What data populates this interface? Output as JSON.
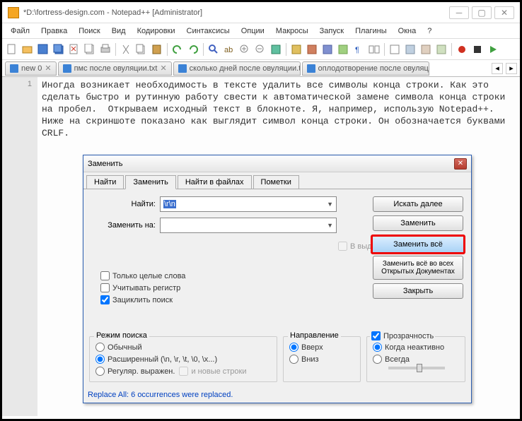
{
  "title": "*D:\\fortress-design.com - Notepad++ [Administrator]",
  "menus": [
    "Файл",
    "Правка",
    "Поиск",
    "Вид",
    "Кодировки",
    "Синтаксисы",
    "Опции",
    "Макросы",
    "Запуск",
    "Плагины",
    "Окна",
    "?"
  ],
  "file_tabs": [
    "new 0",
    "пмс после овуляции.txt",
    "сколько дней после овуляции.txt",
    "оплодотворение после овуляции.txt"
  ],
  "line_num": "1",
  "editor_text": "Иногда возникает необходимость в тексте удалить все символы конца строки. Как это сделать быстро и рутинную работу свести к автоматической замене символа конца строки на пробел.  Открываем исходный текст в блокноте. Я, например, использую Notepad++.  Ниже на скриншоте показано как выглядит символ конца строки. Он обозначается буквами CRLF.",
  "dlg": {
    "title": "Заменить",
    "tabs": [
      "Найти",
      "Заменить",
      "Найти в файлах",
      "Пометки"
    ],
    "find_lbl": "Найти:",
    "replace_lbl": "Заменить на:",
    "find_val": "\\r\\n",
    "in_sel": "В выделенном",
    "btn_next": "Искать далее",
    "btn_replace": "Заменить",
    "btn_replace_all": "Заменить всё",
    "btn_replace_all_open": "Заменить всё во всех Открытых Документах",
    "btn_close": "Закрыть",
    "chk_whole": "Только целые слова",
    "chk_case": "Учитывать регистр",
    "chk_wrap": "Зациклить поиск",
    "grp_mode": "Режим поиска",
    "mode_normal": "Обычный",
    "mode_ext": "Расширенный (\\n, \\r, \\t, \\0, \\x...)",
    "mode_regex": "Регуляр. выражен.",
    "mode_newline": "и новые строки",
    "grp_dir": "Направление",
    "dir_up": "Вверх",
    "dir_down": "Вниз",
    "chk_trans": "Прозрачность",
    "trans_inactive": "Когда неактивно",
    "trans_always": "Всегда",
    "status": "Replace All: 6 occurrences were replaced."
  }
}
